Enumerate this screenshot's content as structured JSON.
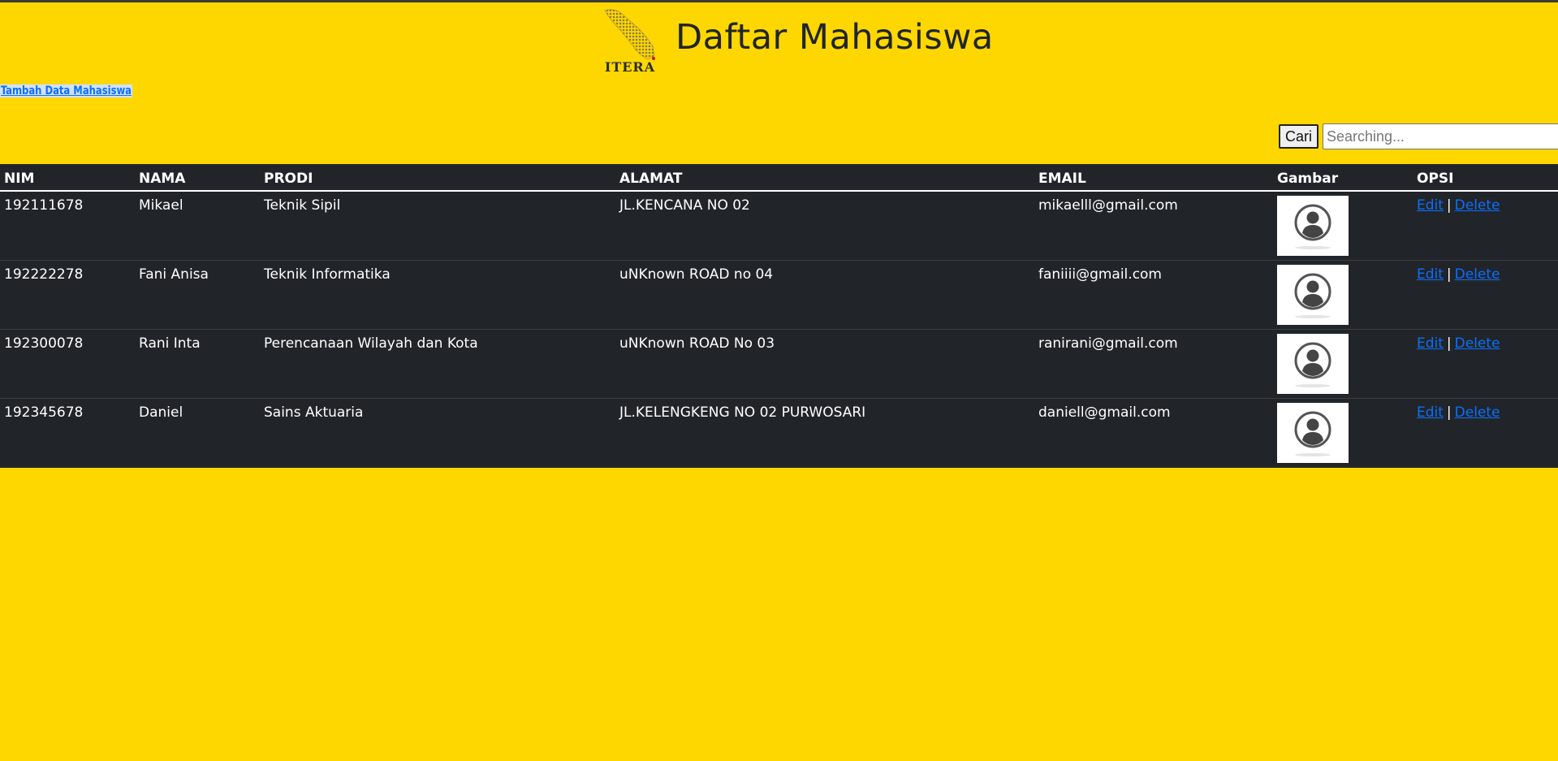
{
  "header": {
    "logo_text": "ITERA",
    "title": "Daftar Mahasiswa"
  },
  "add_link": "Tambah Data Mahasiswa",
  "search": {
    "button_label": "Cari",
    "placeholder": "Searching..."
  },
  "table": {
    "headers": [
      "NIM",
      "NAMA",
      "PRODI",
      "ALAMAT",
      "EMAIL",
      "Gambar",
      "OPSI"
    ],
    "rows": [
      {
        "nim": "192111678",
        "nama": "Mikael",
        "prodi": "Teknik Sipil",
        "alamat": "JL.KENCANA NO 02",
        "email": "mikaelll@gmail.com",
        "gambar": "avatar-placeholder",
        "edit": "Edit",
        "sep": "|",
        "delete": "Delete"
      },
      {
        "nim": "192222278",
        "nama": "Fani Anisa",
        "prodi": "Teknik Informatika",
        "alamat": "uNKnown ROAD no 04",
        "email": "faniiii@gmail.com",
        "gambar": "avatar-placeholder",
        "edit": "Edit",
        "sep": "|",
        "delete": "Delete"
      },
      {
        "nim": "192300078",
        "nama": "Rani Inta",
        "prodi": "Perencanaan Wilayah dan Kota",
        "alamat": "uNKnown ROAD No 03",
        "email": "ranirani@gmail.com",
        "gambar": "avatar-placeholder",
        "edit": "Edit",
        "sep": "|",
        "delete": "Delete"
      },
      {
        "nim": "192345678",
        "nama": "Daniel",
        "prodi": "Sains Aktuaria",
        "alamat": "JL.KELENGKENG NO 02 PURWOSARI",
        "email": "daniell@gmail.com",
        "gambar": "avatar-placeholder",
        "edit": "Edit",
        "sep": "|",
        "delete": "Delete"
      }
    ]
  },
  "colors": {
    "page_background": "#ffd700",
    "table_background": "#212529",
    "link": "#0d6efd"
  }
}
